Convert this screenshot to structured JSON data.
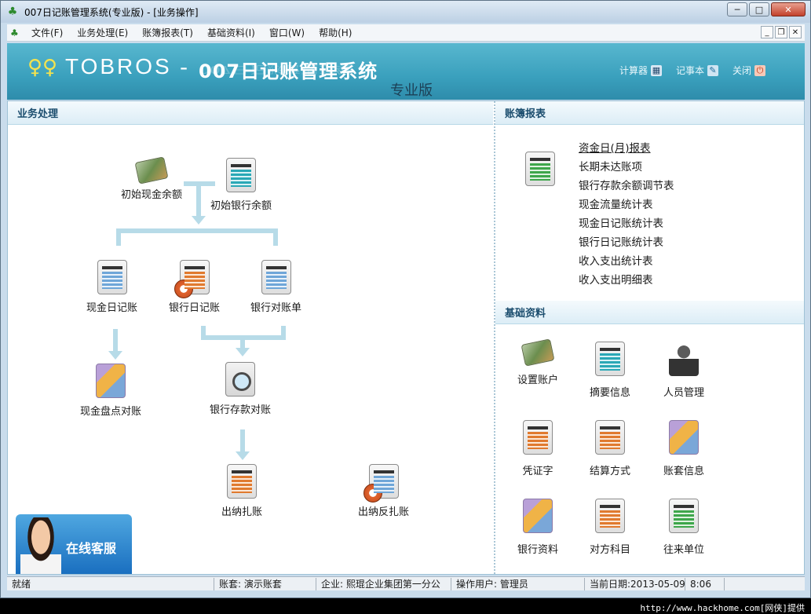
{
  "window": {
    "title": "007日记账管理系统(专业版) - [业务操作]",
    "minimize": "0",
    "maximize": "1",
    "close": "X"
  },
  "menu": [
    "文件(F)",
    "业务处理(E)",
    "账簿报表(T)",
    "基础资料(I)",
    "窗口(W)",
    "帮助(H)"
  ],
  "banner": {
    "brand": "TOBROS",
    "system_name": "007日记账管理系统",
    "edition": "专业版",
    "tools": [
      {
        "label": "计算器",
        "icon": "calculator-icon"
      },
      {
        "label": "记事本",
        "icon": "notepad-icon"
      },
      {
        "label": "关闭",
        "icon": "power-icon"
      }
    ]
  },
  "business": {
    "title": "业务处理",
    "nodes": {
      "init_cash": "初始现金余额",
      "init_bank": "初始银行余额",
      "cash_journal": "现金日记账",
      "bank_journal": "银行日记账",
      "bank_statement": "银行对账单",
      "cash_count": "现金盘点对账",
      "bank_reconcile": "银行存款对账",
      "close_account": "出纳扎账",
      "reverse_close": "出纳反扎账"
    }
  },
  "reports": {
    "title": "账簿报表",
    "items": [
      "资金日(月)报表",
      "长期未达账项",
      "银行存款余额调节表",
      "现金流量统计表",
      "现金日记账统计表",
      "银行日记账统计表",
      "收入支出统计表",
      "收入支出明细表"
    ]
  },
  "basic": {
    "title": "基础资料",
    "items": [
      "设置账户",
      "摘要信息",
      "人员管理",
      "凭证字",
      "结算方式",
      "账套信息",
      "银行资料",
      "对方科目",
      "往来单位"
    ]
  },
  "service": {
    "label": "在线客服"
  },
  "status": {
    "ready": "就绪",
    "book_label": "账套:",
    "book": "演示账套",
    "company_label": "企业:",
    "company": "熙琨企业集团第一分公",
    "user_label": "操作用户:",
    "user": "管理员",
    "date_label": "当前日期:",
    "date": "2013-05-09",
    "time": "8:06"
  },
  "footer": "http://www.hackhome.com[网侠]提供"
}
